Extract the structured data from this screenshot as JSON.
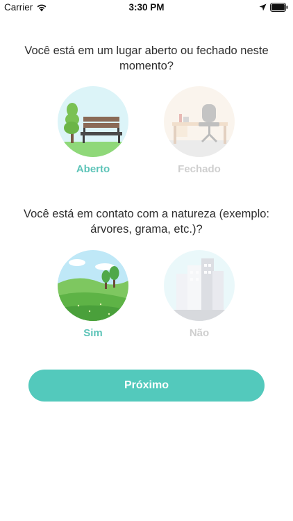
{
  "status_bar": {
    "carrier": "Carrier",
    "time": "3:30 PM",
    "icons": [
      "wifi-icon",
      "location-arrow-icon",
      "battery-icon"
    ]
  },
  "question_location": {
    "text": "Você está em um lugar aberto ou fechado neste momento?",
    "options": [
      {
        "label": "Aberto",
        "icon": "park-bench-icon",
        "selected": true
      },
      {
        "label": "Fechado",
        "icon": "desk-chair-icon",
        "selected": false
      }
    ]
  },
  "question_nature": {
    "text": "Você está em contato com a natureza (exemplo: árvores, grama, etc.)?",
    "options": [
      {
        "label": "Sim",
        "icon": "hills-trees-icon",
        "selected": true
      },
      {
        "label": "Não",
        "icon": "city-buildings-icon",
        "selected": false
      }
    ]
  },
  "next_button": {
    "label": "Próximo"
  },
  "colors": {
    "accent": "#53c9bc",
    "selected_label": "#5dc4b8",
    "unselected_label": "#cfcfcf",
    "text": "#2e2e2e"
  }
}
